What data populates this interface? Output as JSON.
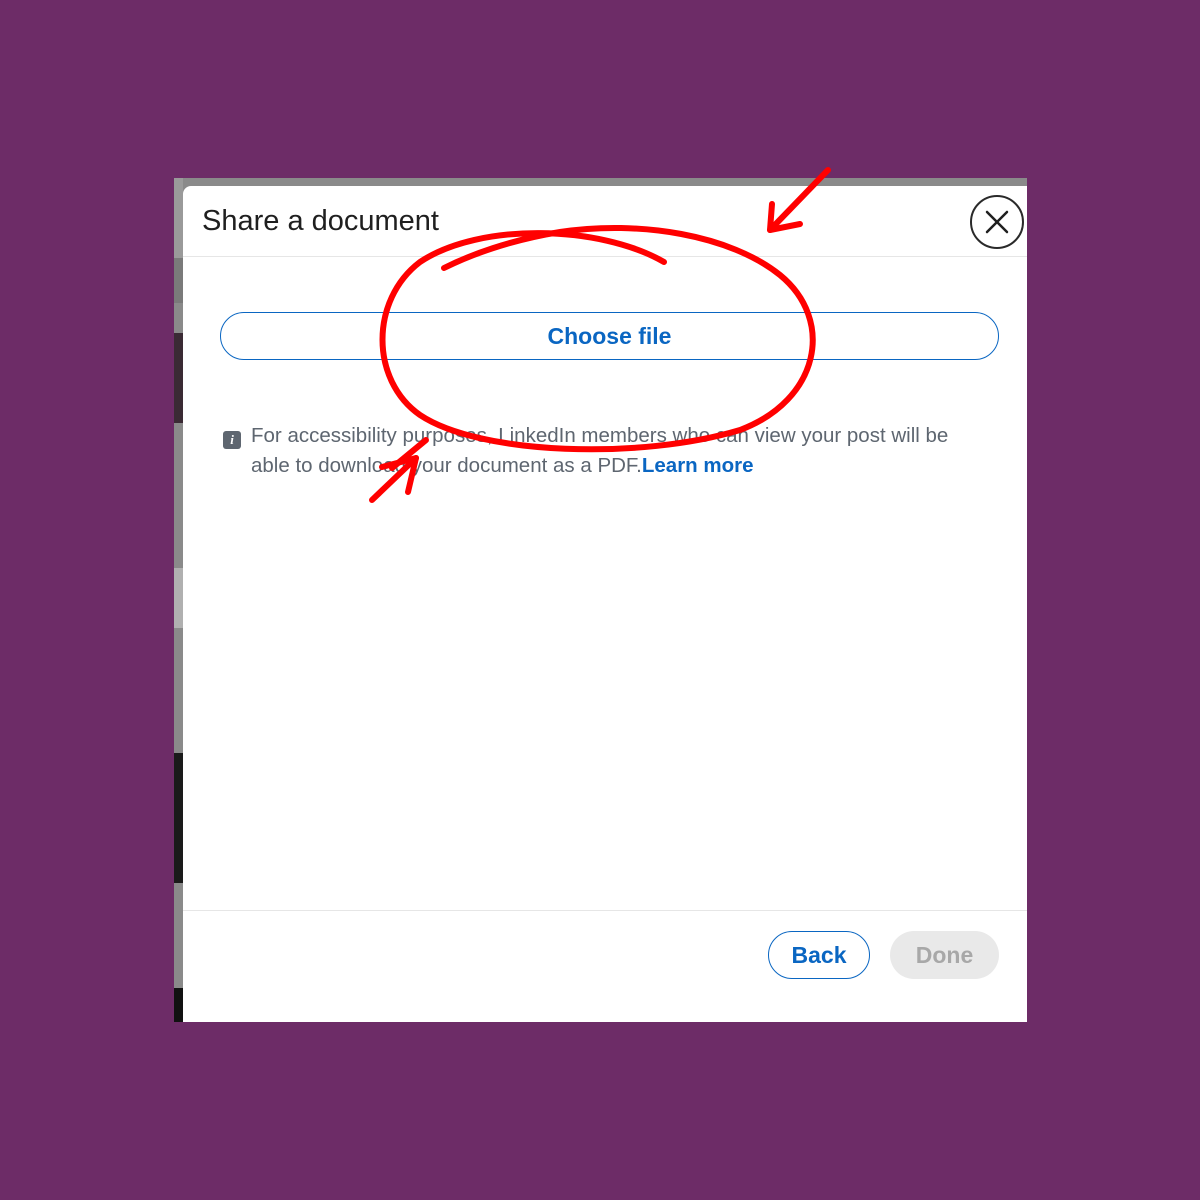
{
  "modal": {
    "title": "Share a document",
    "close_icon": "close-icon",
    "choose_file_label": "Choose file",
    "info_icon": "info-icon",
    "info_text": "For accessibility purposes, LinkedIn members who can view your post will be able to download your document as a PDF.",
    "learn_more_label": "Learn more"
  },
  "footer": {
    "back_label": "Back",
    "done_label": "Done",
    "done_disabled": true
  },
  "annotations": {
    "color": "#ff0000",
    "marks": [
      "red-ellipse-around-choose-file",
      "arrow-top-right",
      "arrow-bottom-left"
    ]
  },
  "colors": {
    "background": "#6d2c67",
    "accent": "#0a66c2"
  }
}
